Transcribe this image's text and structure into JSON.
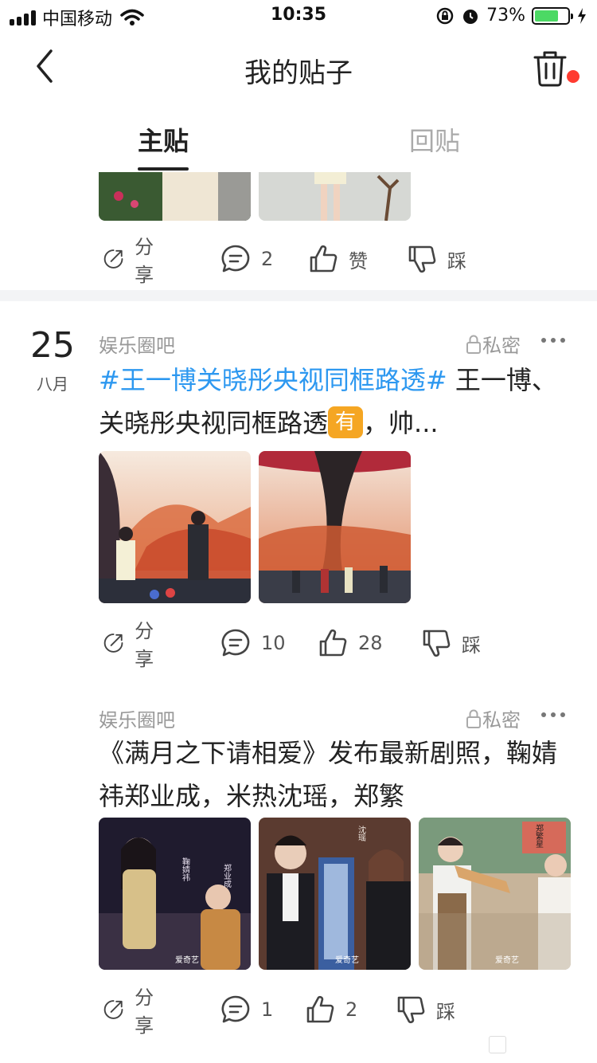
{
  "status_bar": {
    "carrier": "中国移动",
    "time": "10:35",
    "battery": "73%",
    "battery_level": 0.73
  },
  "nav": {
    "title": "我的贴子"
  },
  "tabs": {
    "main": "主贴",
    "reply": "回贴"
  },
  "colors": {
    "hashtag": "#2d98f0",
    "badge": "#f5a623",
    "notification_dot": "#ff3b30",
    "battery": "#4cd964"
  },
  "posts": [
    {
      "actions": {
        "share": "分享",
        "comments": "2",
        "like": "赞",
        "dislike": "踩"
      }
    },
    {
      "day": "25",
      "month": "八月",
      "forum": "娱乐圈吧",
      "privacy": "私密",
      "hashtag": "#王一博关晓彤央视同框路透#",
      "text_after": " 王一博、关晓彤央视同框路透",
      "badge": "有",
      "text_end": "，帅...",
      "actions": {
        "share": "分享",
        "comments": "10",
        "like": "28",
        "dislike": "踩"
      }
    },
    {
      "forum": "娱乐圈吧",
      "privacy": "私密",
      "text": "《满月之下请相爱》发布最新剧照，鞠婧祎郑业成，米热沈瑶，郑繁",
      "image_caption_names": [
        "鞠婧祎",
        "郑业成",
        "沈瑶",
        "郑繁星"
      ],
      "image_watermark": "爱奇艺",
      "actions": {
        "share": "分享",
        "comments": "1",
        "like": "2",
        "dislike": "踩"
      }
    }
  ]
}
